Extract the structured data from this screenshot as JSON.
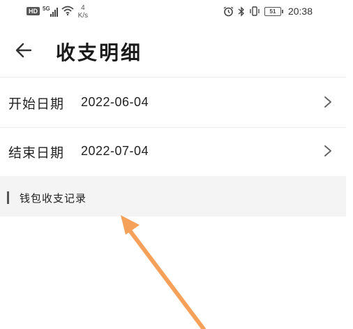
{
  "status_bar": {
    "hd_badge": "HD",
    "network": "5G",
    "speed_value": "4",
    "speed_unit": "K/s",
    "battery": "51",
    "time": "20:38",
    "icons": [
      "signal-icon",
      "wifi-icon",
      "alarm-icon",
      "bluetooth-icon",
      "vibrate-icon",
      "battery-icon"
    ]
  },
  "header": {
    "title": "收支明细",
    "back_icon": "back-arrow-icon"
  },
  "filters": {
    "start": {
      "label": "开始日期",
      "value": "2022-06-04"
    },
    "end": {
      "label": "结束日期",
      "value": "2022-07-04"
    }
  },
  "section": {
    "title": "钱包收支记录"
  },
  "colors": {
    "background": "#ffffff",
    "section_background": "#f4f4f4",
    "accent_bar": "#555555",
    "annotation_arrow": "#f5a15a"
  }
}
